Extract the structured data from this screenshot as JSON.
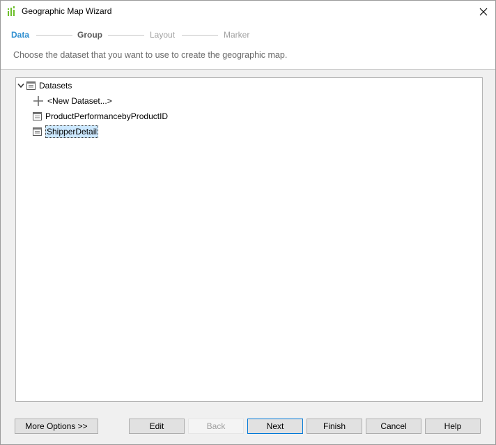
{
  "window": {
    "title": "Geographic Map Wizard"
  },
  "steps": [
    {
      "label": "Data",
      "state": "active"
    },
    {
      "label": "Group",
      "state": "visited"
    },
    {
      "label": "Layout",
      "state": "future"
    },
    {
      "label": "Marker",
      "state": "future"
    }
  ],
  "instruction": "Choose the dataset that you want to use to create the geographic map.",
  "tree": {
    "root": {
      "label": "Datasets",
      "expanded": true
    },
    "new_dataset_label": "<New Dataset...>",
    "datasets": [
      {
        "label": "ProductPerformancebyProductID",
        "selected": false
      },
      {
        "label": "ShipperDetail",
        "selected": true
      }
    ]
  },
  "buttons": {
    "more_options": "More Options >>",
    "edit": "Edit",
    "back": "Back",
    "next": "Next",
    "finish": "Finish",
    "cancel": "Cancel",
    "help": "Help"
  },
  "colors": {
    "active_step": "#2f8fd0",
    "selection": "#cce8ff",
    "default_button_border": "#0078d7"
  }
}
